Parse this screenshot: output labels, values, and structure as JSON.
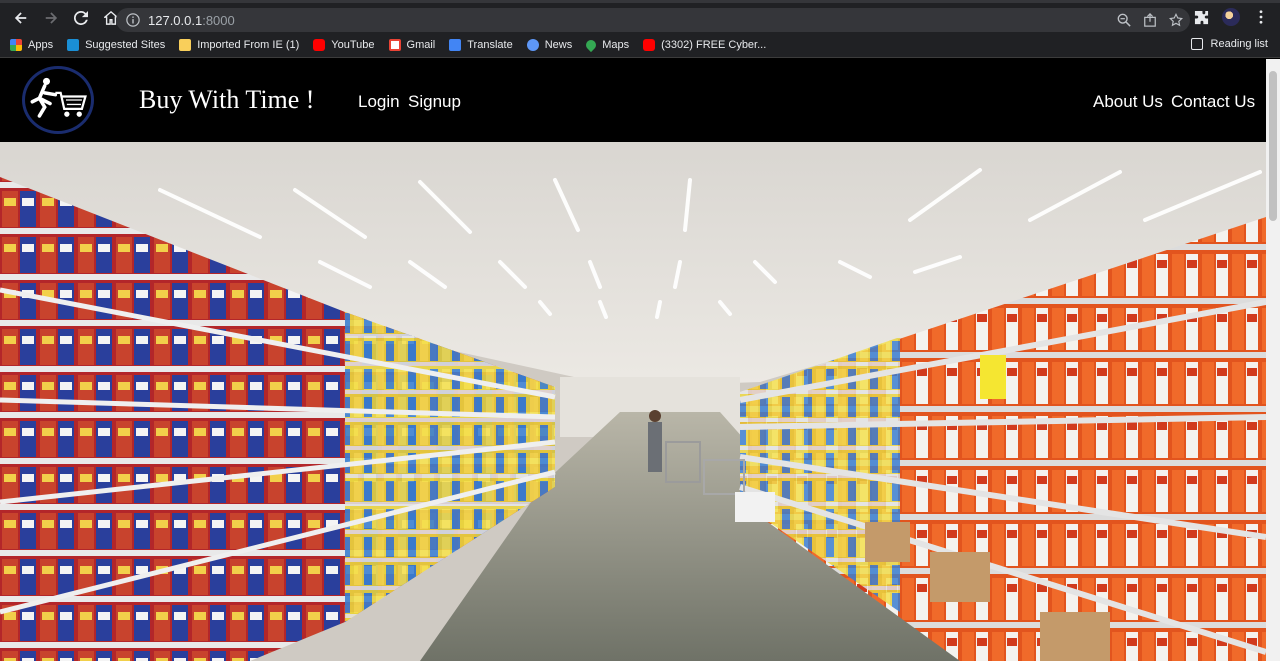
{
  "browser": {
    "url_host": "127.0.0.1",
    "url_port": ":8000",
    "bookmarks": [
      {
        "label": "Apps",
        "color": "#e8453c"
      },
      {
        "label": "Suggested Sites",
        "color": "#1a73e8"
      },
      {
        "label": "Imported From IE (1)",
        "color": "#f9cf5b"
      },
      {
        "label": "YouTube",
        "color": "#ff0000"
      },
      {
        "label": "Gmail",
        "color": "#ea4335"
      },
      {
        "label": "Translate",
        "color": "#4285f4"
      },
      {
        "label": "News",
        "color": "#5e97f6"
      },
      {
        "label": "Maps",
        "color": "#34a853"
      },
      {
        "label": "(3302) FREE Cyber...",
        "color": "#ff0000"
      }
    ],
    "reading_list": "Reading list"
  },
  "site": {
    "brand": "Buy With Time !",
    "nav_left": [
      "Login",
      "Signup"
    ],
    "nav_right": [
      "About Us",
      "Contact Us"
    ]
  }
}
